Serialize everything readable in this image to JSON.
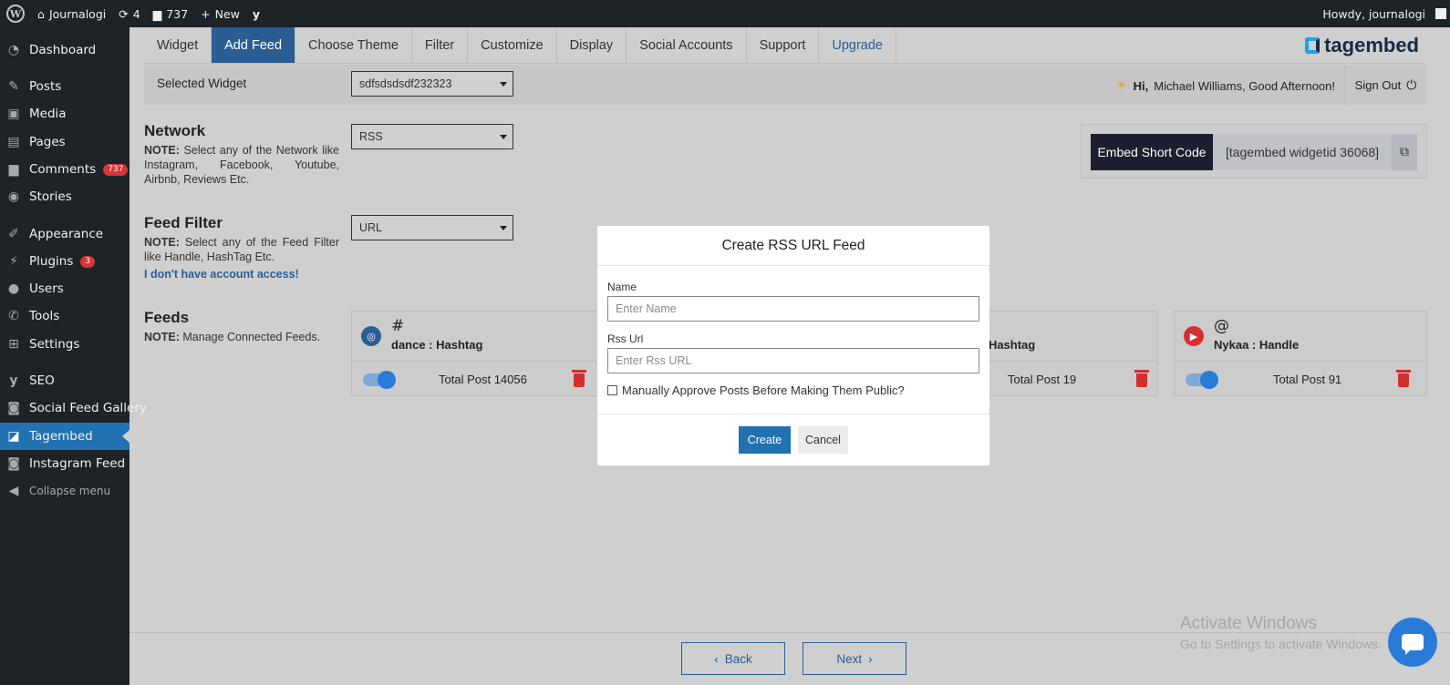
{
  "adminbar": {
    "site_name": "Journalogi",
    "updates_count": "4",
    "comments_count": "737",
    "new_label": "New",
    "howdy": "Howdy, journalogi"
  },
  "sidebar": {
    "items": [
      {
        "label": "Dashboard",
        "icon": "dashboard-icon"
      },
      {
        "label": "Posts",
        "icon": "pin-icon"
      },
      {
        "label": "Media",
        "icon": "media-icon"
      },
      {
        "label": "Pages",
        "icon": "pages-icon"
      },
      {
        "label": "Comments",
        "icon": "comment-icon",
        "badge": "737"
      },
      {
        "label": "Stories",
        "icon": "stories-icon"
      },
      {
        "label": "Appearance",
        "icon": "brush-icon"
      },
      {
        "label": "Plugins",
        "icon": "plug-icon",
        "badge": "3"
      },
      {
        "label": "Users",
        "icon": "user-icon"
      },
      {
        "label": "Tools",
        "icon": "wrench-icon"
      },
      {
        "label": "Settings",
        "icon": "settings-icon"
      },
      {
        "label": "SEO",
        "icon": "yoast-icon"
      },
      {
        "label": "Social Feed Gallery",
        "icon": "camera-icon"
      },
      {
        "label": "Tagembed",
        "icon": "tagembed-icon"
      },
      {
        "label": "Instagram Feed",
        "icon": "camera-icon"
      },
      {
        "label": "Collapse menu",
        "icon": "collapse-icon"
      }
    ]
  },
  "tabs": [
    {
      "label": "Widget"
    },
    {
      "label": "Add Feed"
    },
    {
      "label": "Choose Theme"
    },
    {
      "label": "Filter"
    },
    {
      "label": "Customize"
    },
    {
      "label": "Display"
    },
    {
      "label": "Social Accounts"
    },
    {
      "label": "Support"
    },
    {
      "label": "Upgrade"
    }
  ],
  "brand": "tagembed",
  "widget": {
    "label": "Selected Widget",
    "value": "sdfsdsdsdf232323",
    "greeting_hi": "Hi,",
    "greeting_text": "Michael Williams, Good Afternoon!",
    "signout": "Sign Out"
  },
  "network": {
    "title": "Network",
    "note_bold": "NOTE:",
    "note": "Select any of the Network like Instagram, Facebook, Youtube, Airbnb, Reviews Etc.",
    "value": "RSS"
  },
  "feed_filter": {
    "title": "Feed Filter",
    "note_bold": "NOTE:",
    "note": "Select any of the Feed Filter like Handle, HashTag Etc.",
    "value": "URL",
    "link": "I don't have account access!"
  },
  "embed": {
    "label": "Embed Short Code",
    "code": "[tagembed widgetid 36068]"
  },
  "feeds": {
    "title": "Feeds",
    "note_bold": "NOTE:",
    "note": "Manage Connected Feeds.",
    "cards": [
      {
        "symbol": "#",
        "name": "dance : Hashtag",
        "total": "Total Post 14056",
        "icon": "instagram-icon"
      },
      {
        "symbol": "",
        "name": ": Hashtag",
        "total": "Total Post 19",
        "icon": ""
      },
      {
        "symbol": "@",
        "name": "Nykaa : Handle",
        "total": "Total Post 91",
        "icon": "youtube-icon"
      }
    ]
  },
  "modal": {
    "title": "Create RSS URL Feed",
    "name_label": "Name",
    "name_placeholder": "Enter Name",
    "url_label": "Rss Url",
    "url_placeholder": "Enter Rss URL",
    "approve_label": "Manually Approve Posts Before Making Them Public?",
    "create": "Create",
    "cancel": "Cancel"
  },
  "nav": {
    "back": "Back",
    "next": "Next"
  },
  "watermark": {
    "line1": "Activate Windows",
    "line2": "Go to Settings to activate Windows."
  },
  "colors": {
    "accent": "#2271b1",
    "tab_active": "#2a5d94",
    "danger": "#d32f2f",
    "sidebar": "#1d2327"
  }
}
